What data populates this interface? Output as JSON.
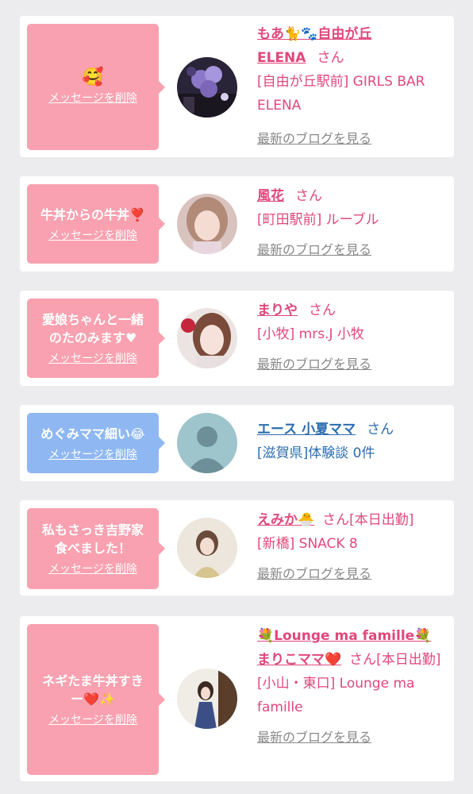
{
  "delete_label": "メッセージを削除",
  "suffix_san": "さん",
  "blog_label": "最新のブログを見る",
  "colors": {
    "background": "#ececee",
    "pink_bubble": "#f9a1b0",
    "blue_bubble": "#8fb8f2",
    "pink_text": "#e0487a",
    "blue_text": "#2c6db0",
    "link_gray": "#888888"
  },
  "items": [
    {
      "message": "🥰",
      "bubble_color": "pink",
      "name_line1": "もあ🐈🐾自由が丘",
      "name_line2": "ELENA",
      "shop": "[自由が丘駅前] GIRLS BAR ELENA",
      "avatar": "balloons-photo"
    },
    {
      "message": "牛丼からの牛丼❣️",
      "bubble_color": "pink",
      "name": "風花",
      "shop": "[町田駅前] ルーブル",
      "avatar": "girl-portrait-photo"
    },
    {
      "message": "愛娘ちゃんと一緒\nのたのみます♥",
      "bubble_color": "pink",
      "name": "まりや",
      "shop": "[小牧] mrs.J 小牧",
      "avatar": "girl-portrait-photo"
    },
    {
      "message": "めぐみママ細い😂",
      "bubble_color": "blue",
      "name": "エース 小夏ママ",
      "shop": "[滋賀県]体験談 0件",
      "avatar": "no-photo-placeholder"
    },
    {
      "message": "私もさっき吉野家\n食べました！",
      "bubble_color": "pink",
      "name": "えみか🐣",
      "status": "[本日出勤]",
      "shop": "[新橋] SNACK 8",
      "avatar": "girl-portrait-photo"
    },
    {
      "message": "ネギたま牛丼すき\nー❤️✨",
      "bubble_color": "pink",
      "name_line1": "💐Lounge ma famille💐",
      "name_line2": "まりこママ❤️",
      "status": "[本日出勤]",
      "shop": "[小山・東口] Lounge ma famille",
      "avatar": "kimono-portrait-photo"
    }
  ]
}
